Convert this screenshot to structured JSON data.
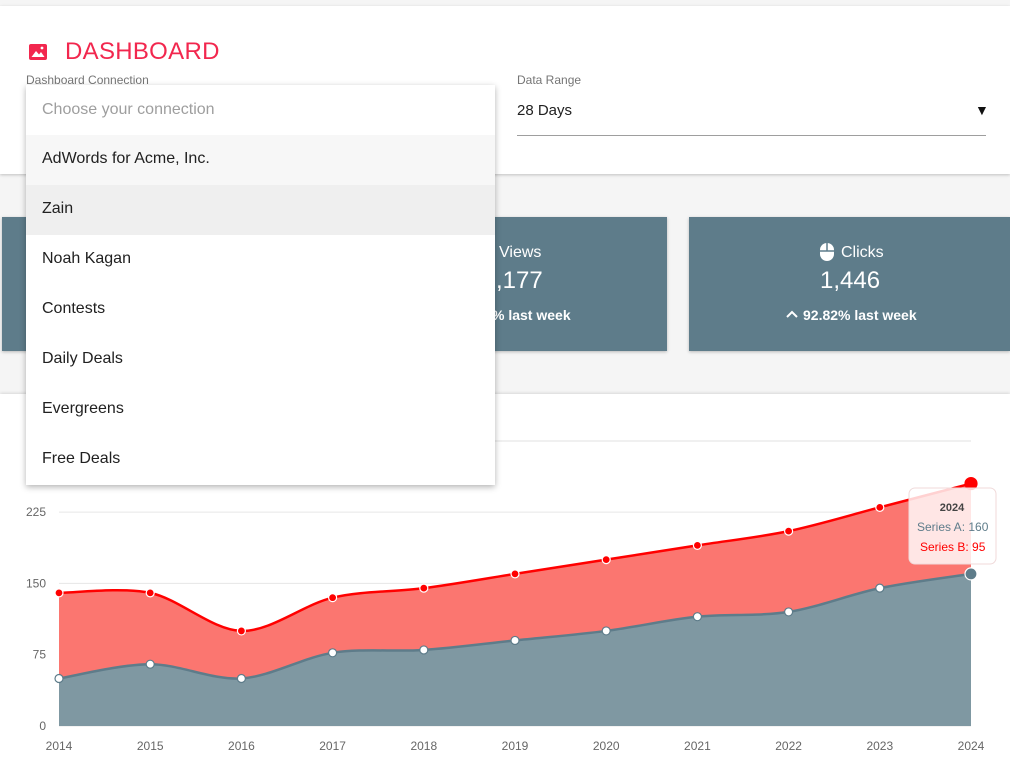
{
  "header": {
    "title": "DASHBOARD",
    "title_icon": "image-icon",
    "accent_color": "#f2274e"
  },
  "filters": {
    "connection_label": "Dashboard Connection",
    "connection_placeholder": "Choose your connection",
    "range_label": "Data Range",
    "range_value": "28 Days",
    "range_arrow": "▼"
  },
  "dropdown": {
    "options": [
      {
        "label": "AdWords for Acme, Inc.",
        "state": "hovered"
      },
      {
        "label": "Zain",
        "state": "selected"
      },
      {
        "label": "Noah Kagan",
        "state": ""
      },
      {
        "label": "Contests",
        "state": ""
      },
      {
        "label": "Daily Deals",
        "state": ""
      },
      {
        "label": "Evergreens",
        "state": ""
      },
      {
        "label": "Free Deals",
        "state": ""
      }
    ]
  },
  "cards": {
    "color": "#5e7c8a",
    "views": {
      "label": "Views",
      "value_visible": ",177",
      "change_visible": "% last week"
    },
    "clicks": {
      "icon": "mouse-icon",
      "label": "Clicks",
      "value": "1,446",
      "change_arrow": "chevron-up-icon",
      "change": "92.82% last week"
    }
  },
  "chart_data": {
    "type": "area",
    "stacked": true,
    "x": [
      "2014",
      "2015",
      "2016",
      "2017",
      "2018",
      "2019",
      "2020",
      "2021",
      "2022",
      "2023",
      "2024"
    ],
    "yticks": [
      "0",
      "75",
      "150",
      "225"
    ],
    "ylim": [
      0,
      300
    ],
    "grid": true,
    "series": [
      {
        "name": "Series A",
        "color": "#5e7c8a",
        "fill": "#7f98a2",
        "values": [
          50,
          65,
          50,
          77,
          80,
          90,
          100,
          115,
          120,
          145,
          160
        ]
      },
      {
        "name": "Series B",
        "color": "#ff0000",
        "fill": "#fb7670",
        "values": [
          90,
          75,
          50,
          58,
          65,
          70,
          75,
          75,
          85,
          85,
          95
        ]
      }
    ],
    "tooltip": {
      "title": "2024",
      "lines": [
        "Series A: 160",
        "Series B: 95"
      ]
    }
  }
}
